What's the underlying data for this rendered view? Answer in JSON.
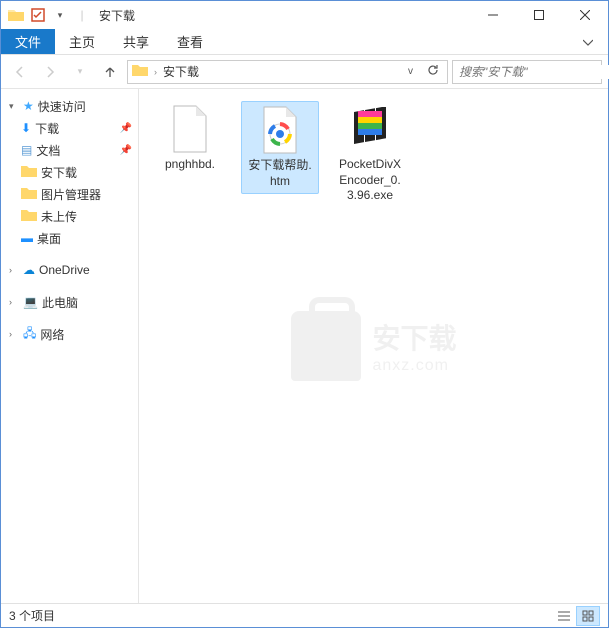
{
  "window": {
    "title": "安下载"
  },
  "ribbon": {
    "file": "文件",
    "tabs": [
      "主页",
      "共享",
      "查看"
    ]
  },
  "address": {
    "crumb": "安下载",
    "search_placeholder": "搜索\"安下载\""
  },
  "sidebar": {
    "quick_access": "快速访问",
    "items": [
      {
        "label": "下载",
        "pinned": true
      },
      {
        "label": "文档",
        "pinned": true
      },
      {
        "label": "安下载",
        "pinned": false
      },
      {
        "label": "图片管理器",
        "pinned": false
      },
      {
        "label": "未上传",
        "pinned": false
      },
      {
        "label": "桌面",
        "pinned": false
      }
    ],
    "onedrive": "OneDrive",
    "thispc": "此电脑",
    "network": "网络"
  },
  "files": [
    {
      "name": "pnghhbd.",
      "type": "file"
    },
    {
      "name": "安下载帮助.htm",
      "type": "htm",
      "selected": true
    },
    {
      "name": "PocketDivXEncoder_0.3.96.exe",
      "type": "exe"
    }
  ],
  "status": {
    "count": "3 个项目"
  },
  "watermark": {
    "line1": "安下载",
    "line2": "anxz.com"
  }
}
